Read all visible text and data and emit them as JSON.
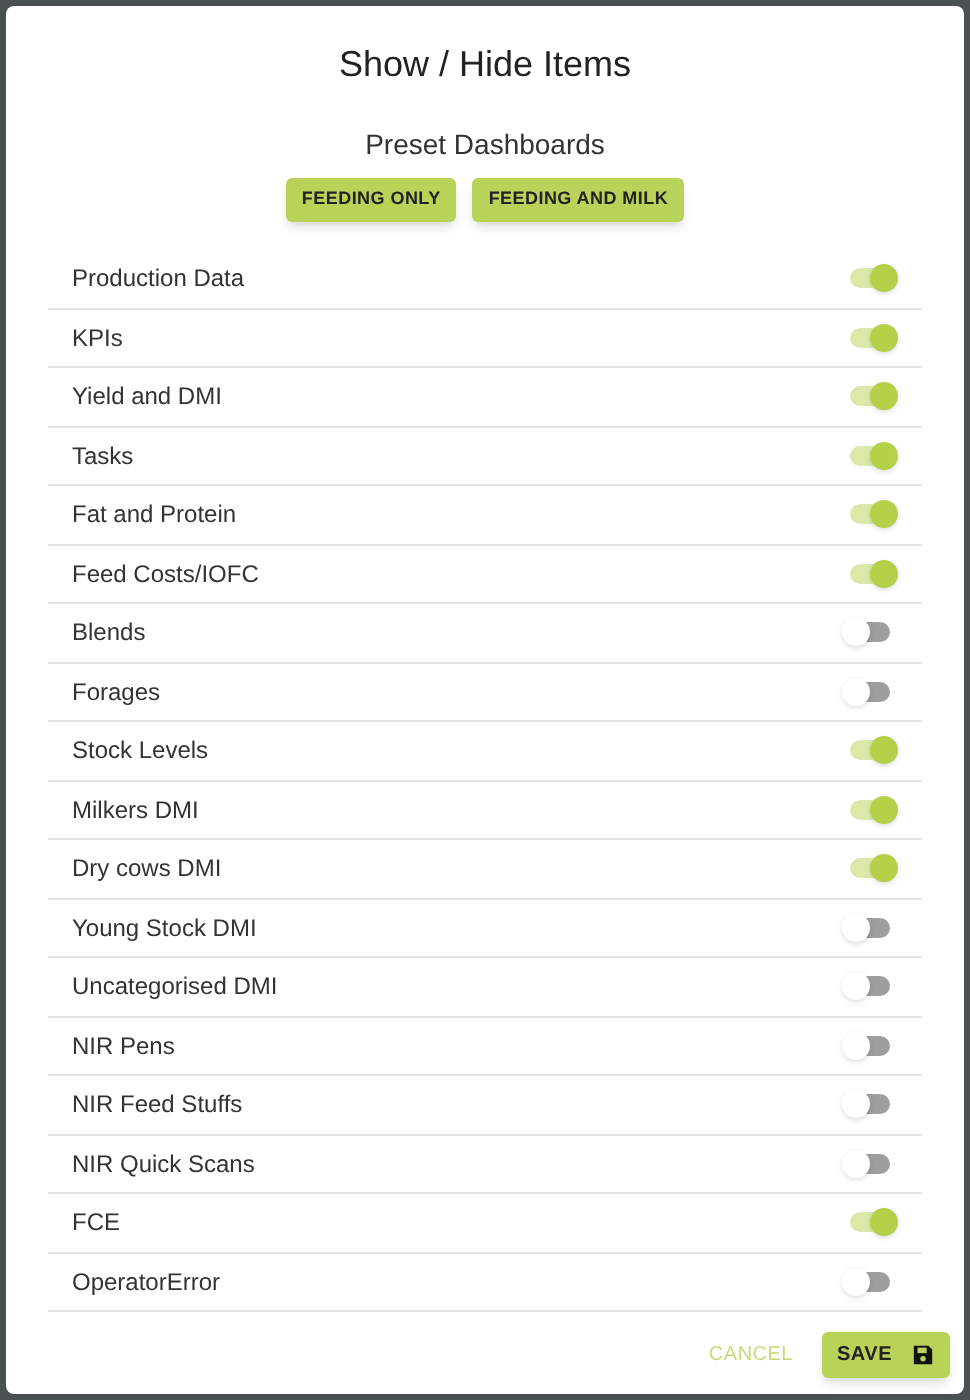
{
  "dialog": {
    "title": "Show / Hide Items",
    "preset_heading": "Preset Dashboards",
    "presets": [
      "FEEDING ONLY",
      "FEEDING AND MILK"
    ],
    "items": [
      {
        "label": "Production Data",
        "on": true
      },
      {
        "label": "KPIs",
        "on": true
      },
      {
        "label": "Yield and DMI",
        "on": true
      },
      {
        "label": "Tasks",
        "on": true
      },
      {
        "label": "Fat and Protein",
        "on": true
      },
      {
        "label": "Feed Costs/IOFC",
        "on": true
      },
      {
        "label": "Blends",
        "on": false
      },
      {
        "label": "Forages",
        "on": false
      },
      {
        "label": "Stock Levels",
        "on": true
      },
      {
        "label": "Milkers DMI",
        "on": true
      },
      {
        "label": "Dry cows DMI",
        "on": true
      },
      {
        "label": "Young Stock DMI",
        "on": false
      },
      {
        "label": "Uncategorised DMI",
        "on": false
      },
      {
        "label": "NIR Pens",
        "on": false
      },
      {
        "label": "NIR Feed Stuffs",
        "on": false
      },
      {
        "label": "NIR Quick Scans",
        "on": false
      },
      {
        "label": "FCE",
        "on": true
      },
      {
        "label": "OperatorError",
        "on": false
      }
    ],
    "cancel": "CANCEL",
    "save": "SAVE"
  }
}
